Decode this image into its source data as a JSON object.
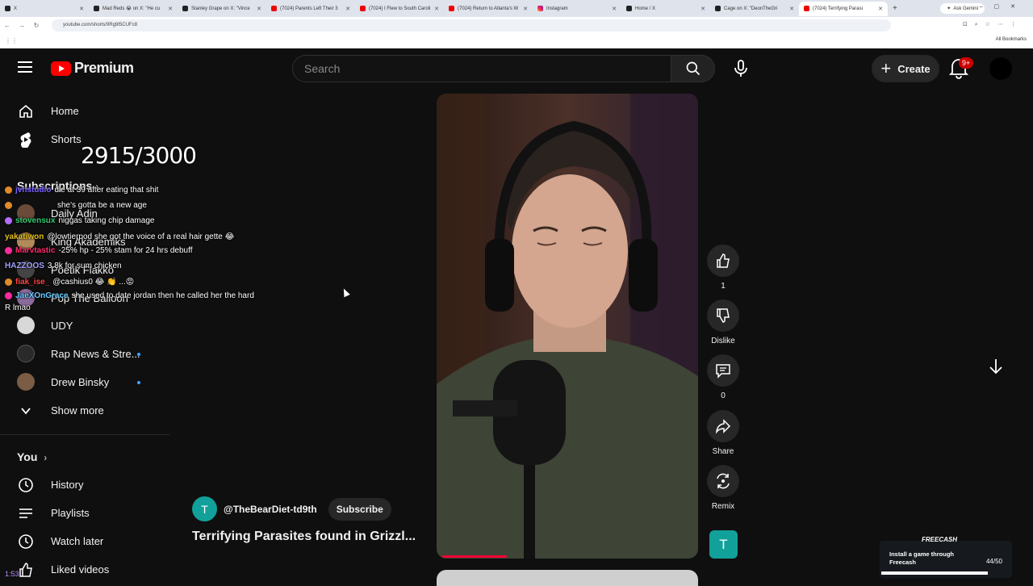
{
  "browser": {
    "tabs": [
      {
        "title": "X",
        "icon": "x-icon"
      },
      {
        "title": "Mad Reds 😭 on X: \"He cu",
        "icon": "x-icon"
      },
      {
        "title": "Stanley Grape on X: \"Vince",
        "icon": "x-icon"
      },
      {
        "title": "(7024) Parents Left Their 3",
        "icon": "youtube-icon"
      },
      {
        "title": "(7024) I Flew to South Caroli",
        "icon": "youtube-icon"
      },
      {
        "title": "(7024) Return to Atlanta's W",
        "icon": "youtube-icon"
      },
      {
        "title": "Instagram",
        "icon": "instagram-icon"
      },
      {
        "title": "Home / X",
        "icon": "x-icon"
      },
      {
        "title": "Cage on X: \"DeonTheGri",
        "icon": "x-icon"
      },
      {
        "title": "(7024) Terrifying Parasi",
        "icon": "youtube-icon"
      }
    ],
    "gemini_label": "Ask Gemini",
    "url": "youtube.com/shorts/9Rg9t5CUFc8",
    "all_bookmarks": "All Bookmarks"
  },
  "header": {
    "logo_text": "Premium",
    "search_placeholder": "Search",
    "create_label": "Create",
    "notification_badge": "9+"
  },
  "sidebar": {
    "main": [
      {
        "label": "Home",
        "icon": "home-icon"
      },
      {
        "label": "Shorts",
        "icon": "shorts-icon"
      }
    ],
    "subscriptions_title": "Subscriptions",
    "subscriptions": [
      {
        "label": "Daily Adin",
        "color": "#6a4b3a"
      },
      {
        "label": "King Akademiks",
        "color": "#b38b5a"
      },
      {
        "label": "Poetik Flakko",
        "color": "#444444"
      },
      {
        "label": "Pop The Balloon",
        "color": "#8b6b9c"
      },
      {
        "label": "UDY",
        "color": "#d8d8d8"
      },
      {
        "label": "Rap News & Stre...",
        "color": "#2a2a2a",
        "new": true
      },
      {
        "label": "Drew Binsky",
        "color": "#7b5c44",
        "new": true
      }
    ],
    "show_more": "Show more",
    "you_title": "You",
    "you_items": [
      {
        "label": "History",
        "icon": "history-icon"
      },
      {
        "label": "Playlists",
        "icon": "playlists-icon"
      },
      {
        "label": "Watch later",
        "icon": "watch-later-icon"
      },
      {
        "label": "Liked videos",
        "icon": "like-icon"
      }
    ]
  },
  "overlay": {
    "counter": "2915/3000",
    "chat": [
      {
        "user": "jvnstudio",
        "text": "die at 39 after eating that shit",
        "color": "#7b61ff"
      },
      {
        "user": "",
        "text": "she's gotta be a new age",
        "color": "#1e90ff"
      },
      {
        "user": "stovensux",
        "text": "niggas taking chip damage",
        "color": "#2ecc71"
      },
      {
        "user": "yakatiwon",
        "text": "@lowtierpod she got the voice of a real hair gette 😂",
        "color": "#e0c020"
      },
      {
        "user": "Marvtastic",
        "text": "-25% hp - 25% stam for 24 hrs debuff",
        "color": "#ff2a6d"
      },
      {
        "user": "HAZZOOS",
        "text": "3.8k for sum chicken",
        "color": "#a0a0ff"
      },
      {
        "user": "fiak_ise_",
        "text": "@cashius0 😂 👏 ...😡",
        "color": "#ff4444"
      },
      {
        "user": "JaeXOnGrace",
        "text": "she used to date jordan then he called her the hard",
        "color": "#66ccff"
      },
      {
        "user": "",
        "text": "R lmao",
        "color": "#ffffff"
      }
    ]
  },
  "short": {
    "channel_initial": "T",
    "channel_name": "@TheBearDiet-td9th",
    "subscribe_label": "Subscribe",
    "title": "Terrifying Parasites found in Grizzl...",
    "progress": 0.25
  },
  "actions": {
    "likes": "1",
    "dislike_label": "Dislike",
    "comments": "0",
    "share_label": "Share",
    "remix_label": "Remix"
  },
  "freecash": {
    "brand": "FREECASH",
    "message": "Install a game through Freecash",
    "count": "44/50"
  },
  "corner_text": "1:53"
}
